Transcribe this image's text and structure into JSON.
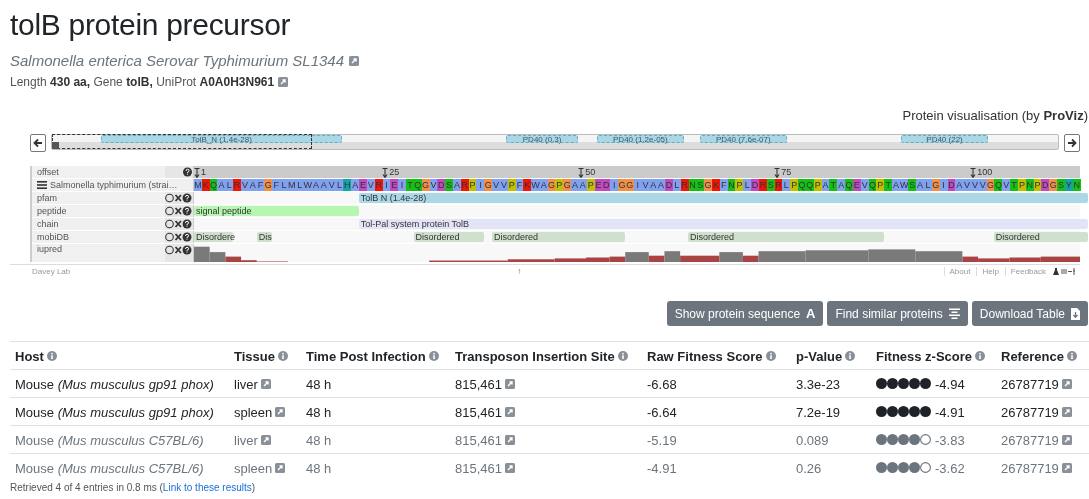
{
  "title": "tolB protein precursor",
  "organism": {
    "name": "Salmonella enterica Serovar Typhimurium SL1344"
  },
  "summary": "Length **430 aa,** Gene **tolB,** UniProt **A0A0H3N961**",
  "viewer": {
    "caption": "Protein visualisation (by **ProViz**)",
    "overview": [
      {
        "label": "TolB_N (1.4e-28)"
      },
      {
        "label": "PD40 (0.3)"
      },
      {
        "label": "PD40 (1.2e-05)"
      },
      {
        "label": "PD40 (7.6e-07)"
      },
      {
        "label": "PD40 (22)"
      }
    ],
    "tracks": [
      {
        "kind": "offset",
        "label": "offset",
        "ticks": [
          "1",
          "25",
          "50",
          "75",
          "100"
        ]
      },
      {
        "kind": "sequence",
        "label": "Salmonella typhimurium (strai…",
        "residues": [
          {
            "aa": "M",
            "color": "#80a0f0"
          },
          {
            "aa": "K",
            "color": "#f01505"
          },
          {
            "aa": "Q",
            "color": "#15c015"
          },
          {
            "aa": "A",
            "color": "#80a0f0"
          },
          {
            "aa": "L",
            "color": "#80a0f0"
          },
          {
            "aa": "R",
            "color": "#f01505"
          },
          {
            "aa": "V",
            "color": "#80a0f0"
          },
          {
            "aa": "A",
            "color": "#80a0f0"
          },
          {
            "aa": "F",
            "color": "#80a0f0"
          },
          {
            "aa": "G",
            "color": "#f09048"
          },
          {
            "aa": "F",
            "color": "#80a0f0"
          },
          {
            "aa": "L",
            "color": "#80a0f0"
          },
          {
            "aa": "M",
            "color": "#80a0f0"
          },
          {
            "aa": "L",
            "color": "#80a0f0"
          },
          {
            "aa": "W",
            "color": "#80a0f0"
          },
          {
            "aa": "A",
            "color": "#80a0f0"
          },
          {
            "aa": "A",
            "color": "#80a0f0"
          },
          {
            "aa": "V",
            "color": "#80a0f0"
          },
          {
            "aa": "L",
            "color": "#80a0f0"
          },
          {
            "aa": "H",
            "color": "#15a4a4"
          },
          {
            "aa": "A",
            "color": "#80a0f0"
          },
          {
            "aa": "E",
            "color": "#c048c0"
          },
          {
            "aa": "V",
            "color": "#80a0f0"
          },
          {
            "aa": "R",
            "color": "#f01505"
          },
          {
            "aa": "I",
            "color": "#80a0f0"
          },
          {
            "aa": "E",
            "color": "#c048c0"
          },
          {
            "aa": "I",
            "color": "#80a0f0"
          },
          {
            "aa": "T",
            "color": "#15c015"
          },
          {
            "aa": "Q",
            "color": "#15c015"
          },
          {
            "aa": "G",
            "color": "#f09048"
          },
          {
            "aa": "V",
            "color": "#80a0f0"
          },
          {
            "aa": "D",
            "color": "#c048c0"
          },
          {
            "aa": "S",
            "color": "#15c015"
          },
          {
            "aa": "A",
            "color": "#80a0f0"
          },
          {
            "aa": "R",
            "color": "#f01505"
          },
          {
            "aa": "P",
            "color": "#c0c000"
          },
          {
            "aa": "I",
            "color": "#80a0f0"
          },
          {
            "aa": "G",
            "color": "#f09048"
          },
          {
            "aa": "V",
            "color": "#80a0f0"
          },
          {
            "aa": "V",
            "color": "#80a0f0"
          },
          {
            "aa": "P",
            "color": "#c0c000"
          },
          {
            "aa": "F",
            "color": "#80a0f0"
          },
          {
            "aa": "K",
            "color": "#f01505"
          },
          {
            "aa": "W",
            "color": "#80a0f0"
          },
          {
            "aa": "A",
            "color": "#80a0f0"
          },
          {
            "aa": "G",
            "color": "#f09048"
          },
          {
            "aa": "P",
            "color": "#c0c000"
          },
          {
            "aa": "G",
            "color": "#f09048"
          },
          {
            "aa": "A",
            "color": "#80a0f0"
          },
          {
            "aa": "A",
            "color": "#80a0f0"
          },
          {
            "aa": "P",
            "color": "#c0c000"
          },
          {
            "aa": "E",
            "color": "#c048c0"
          },
          {
            "aa": "D",
            "color": "#c048c0"
          },
          {
            "aa": "I",
            "color": "#80a0f0"
          },
          {
            "aa": "G",
            "color": "#f09048"
          },
          {
            "aa": "G",
            "color": "#f09048"
          },
          {
            "aa": "I",
            "color": "#80a0f0"
          },
          {
            "aa": "V",
            "color": "#80a0f0"
          },
          {
            "aa": "A",
            "color": "#80a0f0"
          },
          {
            "aa": "A",
            "color": "#80a0f0"
          },
          {
            "aa": "D",
            "color": "#c048c0"
          },
          {
            "aa": "L",
            "color": "#80a0f0"
          },
          {
            "aa": "R",
            "color": "#f01505"
          },
          {
            "aa": "N",
            "color": "#15c015"
          },
          {
            "aa": "S",
            "color": "#15c015"
          },
          {
            "aa": "G",
            "color": "#f09048"
          },
          {
            "aa": "K",
            "color": "#f01505"
          },
          {
            "aa": "F",
            "color": "#80a0f0"
          },
          {
            "aa": "N",
            "color": "#15c015"
          },
          {
            "aa": "P",
            "color": "#c0c000"
          },
          {
            "aa": "L",
            "color": "#80a0f0"
          },
          {
            "aa": "D",
            "color": "#c048c0"
          },
          {
            "aa": "R",
            "color": "#f01505"
          },
          {
            "aa": "S",
            "color": "#15c015"
          },
          {
            "aa": "R",
            "color": "#f01505"
          },
          {
            "aa": "L",
            "color": "#80a0f0"
          },
          {
            "aa": "P",
            "color": "#c0c000"
          },
          {
            "aa": "Q",
            "color": "#15c015"
          },
          {
            "aa": "Q",
            "color": "#15c015"
          },
          {
            "aa": "P",
            "color": "#c0c000"
          },
          {
            "aa": "A",
            "color": "#80a0f0"
          },
          {
            "aa": "T",
            "color": "#15c015"
          },
          {
            "aa": "A",
            "color": "#80a0f0"
          },
          {
            "aa": "Q",
            "color": "#15c015"
          },
          {
            "aa": "E",
            "color": "#c048c0"
          },
          {
            "aa": "V",
            "color": "#80a0f0"
          },
          {
            "aa": "Q",
            "color": "#15c015"
          },
          {
            "aa": "P",
            "color": "#c0c000"
          },
          {
            "aa": "T",
            "color": "#15c015"
          },
          {
            "aa": "A",
            "color": "#80a0f0"
          },
          {
            "aa": "W",
            "color": "#80a0f0"
          },
          {
            "aa": "S",
            "color": "#15c015"
          },
          {
            "aa": "A",
            "color": "#80a0f0"
          },
          {
            "aa": "L",
            "color": "#80a0f0"
          },
          {
            "aa": "G",
            "color": "#f09048"
          },
          {
            "aa": "I",
            "color": "#80a0f0"
          },
          {
            "aa": "D",
            "color": "#c048c0"
          },
          {
            "aa": "A",
            "color": "#80a0f0"
          },
          {
            "aa": "V",
            "color": "#80a0f0"
          },
          {
            "aa": "V",
            "color": "#80a0f0"
          },
          {
            "aa": "V",
            "color": "#80a0f0"
          },
          {
            "aa": "G",
            "color": "#f09048"
          },
          {
            "aa": "Q",
            "color": "#15c015"
          },
          {
            "aa": "V",
            "color": "#80a0f0"
          },
          {
            "aa": "T",
            "color": "#15c015"
          },
          {
            "aa": "P",
            "color": "#c0c000"
          },
          {
            "aa": "N",
            "color": "#15c015"
          },
          {
            "aa": "P",
            "color": "#c0c000"
          },
          {
            "aa": "D",
            "color": "#c048c0"
          },
          {
            "aa": "G",
            "color": "#f09048"
          },
          {
            "aa": "S",
            "color": "#15c015"
          },
          {
            "aa": "Y",
            "color": "#15a4a4"
          },
          {
            "aa": "N",
            "color": "#15c015"
          }
        ]
      },
      {
        "kind": "features",
        "label": "pfam",
        "features": [
          {
            "label": "TolB N (1.4e-28)",
            "color": "#aad8e6"
          }
        ]
      },
      {
        "kind": "features",
        "label": "peptide",
        "features": [
          {
            "label": "signal peptide",
            "color": "#b6f7b0"
          }
        ]
      },
      {
        "kind": "features",
        "label": "chain",
        "features": [
          {
            "label": "Tol-Pal system protein TolB",
            "color": "#e4e4f8"
          }
        ]
      },
      {
        "kind": "features",
        "label": "mobiDB",
        "features": [
          {
            "label": "Disordere",
            "color": "#cfe0cd"
          },
          {
            "label": "Dis",
            "color": "#cfe0cd"
          },
          {
            "label": "Disordered",
            "color": "#cfe0cd"
          },
          {
            "label": "Disordered",
            "color": "#cfe0cd"
          },
          {
            "label": "Disordered",
            "color": "#cfe0cd"
          },
          {
            "label": "Disordered",
            "color": "#cfe0cd"
          }
        ]
      },
      {
        "kind": "plot",
        "label": "iupred"
      }
    ],
    "footer": {
      "credit": "Davey Lab",
      "marker": "↑",
      "links": [
        "About",
        "Help",
        "Feedback"
      ]
    }
  },
  "buttons": [
    {
      "kind": "sequence",
      "label": "Show protein sequence",
      "icon": "A"
    },
    {
      "kind": "similar",
      "label": "Find similar proteins"
    },
    {
      "kind": "download",
      "label": "Download Table"
    }
  ],
  "table": {
    "columns": [
      "Host",
      "Tissue",
      "Time Post Infection",
      "Transposon Insertion Site",
      "Raw Fitness Score",
      "p-Value",
      "Fitness z-Score",
      "Reference"
    ],
    "rows": [
      {
        "host": "Mouse *(Mus musculus gp91 phox)*",
        "tissue": "liver",
        "time": "48 h",
        "site": "815,461",
        "raw_fitness": "-6.68",
        "p_value": "3.3e-23",
        "stars": 5,
        "z_score": "-4.94",
        "reference": "26787719",
        "significant": true
      },
      {
        "host": "Mouse *(Mus musculus gp91 phox)*",
        "tissue": "spleen",
        "time": "48 h",
        "site": "815,461",
        "raw_fitness": "-6.64",
        "p_value": "7.2e-19",
        "stars": 5,
        "z_score": "-4.91",
        "reference": "26787719",
        "significant": true
      },
      {
        "host": "Mouse *(Mus musculus C57BL/6)*",
        "tissue": "liver",
        "time": "48 h",
        "site": "815,461",
        "raw_fitness": "-5.19",
        "p_value": "0.089",
        "stars": 4,
        "z_score": "-3.83",
        "reference": "26787719",
        "significant": false
      },
      {
        "host": "Mouse *(Mus musculus C57BL/6)*",
        "tissue": "spleen",
        "time": "48 h",
        "site": "815,461",
        "raw_fitness": "-4.91",
        "p_value": "0.26",
        "stars": 4,
        "z_score": "-3.62",
        "reference": "26787719",
        "significant": false
      }
    ]
  },
  "status": {
    "before": "Retrieved 4 of 4 entries in 0.8 ms (",
    "link": "Link to these results",
    "after": ")"
  }
}
